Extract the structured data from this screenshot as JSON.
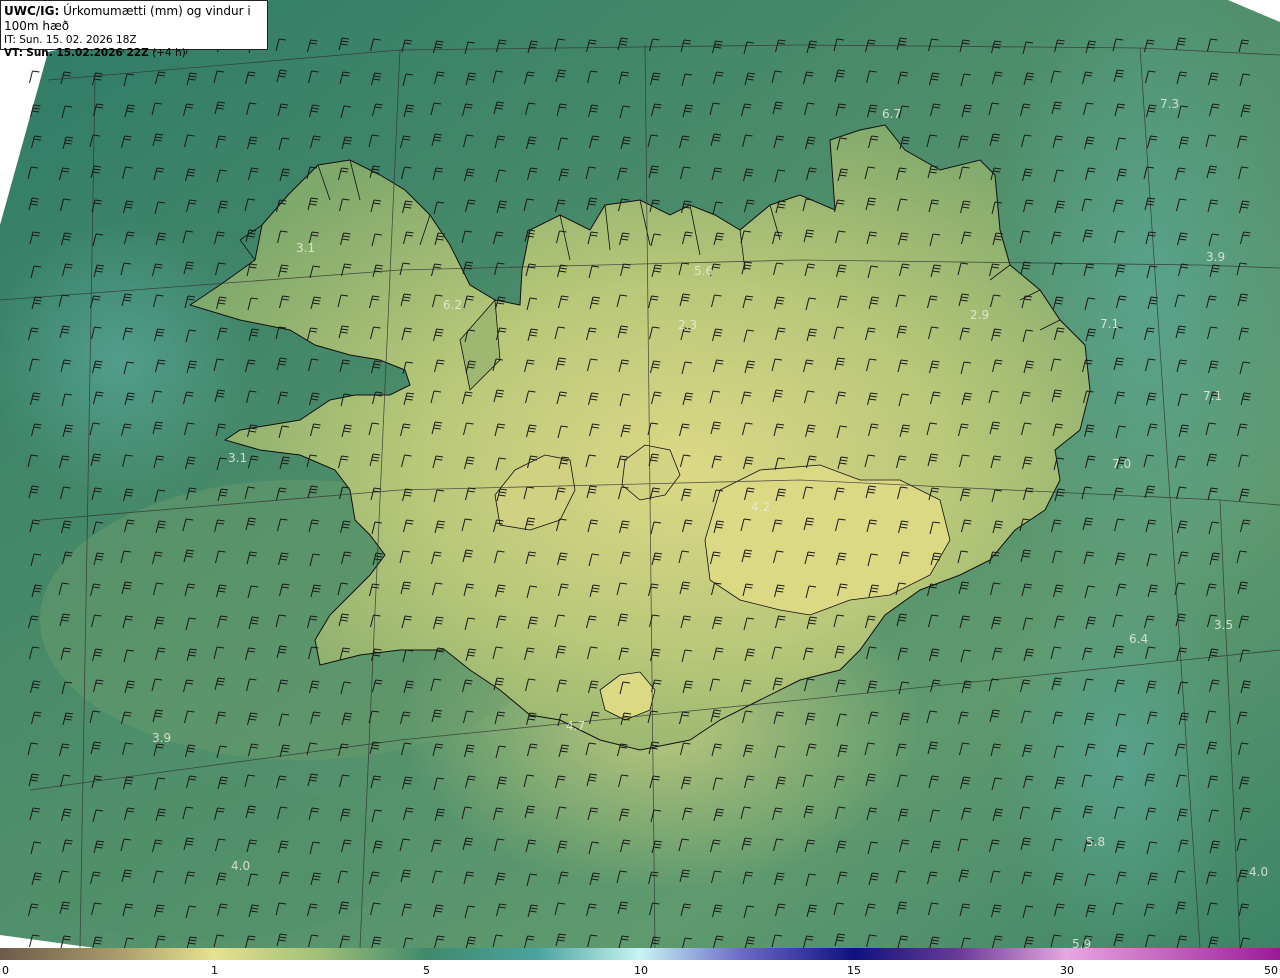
{
  "header": {
    "product": "UWC/IG:",
    "title": "Úrkomumætti (mm) og vindur i 100m hæð",
    "it_prefix": "IT:",
    "it_value": "Sun. 15. 02. 2026 18Z",
    "vt_prefix": "VT:",
    "vt_value": "Sun. 15.02.2026 22Z",
    "vt_offset": "(+4 h)"
  },
  "colors": {
    "ocean_deep": "#2d7a68",
    "ocean_mid": "#3f8a6a",
    "land_low": "#7aa868",
    "land_high": "#d6d682",
    "coastline": "#111111",
    "barb": "#1a1a1a",
    "gridline": "#333333"
  },
  "legend": {
    "ticks": [
      "0",
      "1",
      "5",
      "10",
      "15",
      "30",
      "50"
    ]
  },
  "value_labels": [
    "6.7",
    "7.3",
    "3.1",
    "5.6",
    "6.2",
    "2.3",
    "2.9",
    "3.9",
    "7.1",
    "7.1",
    "7.0",
    "3.1",
    "4.2",
    "3.5",
    "6.4",
    "4.7",
    "3.9",
    "5.8",
    "4.0",
    "4.0",
    "5.9"
  ]
}
